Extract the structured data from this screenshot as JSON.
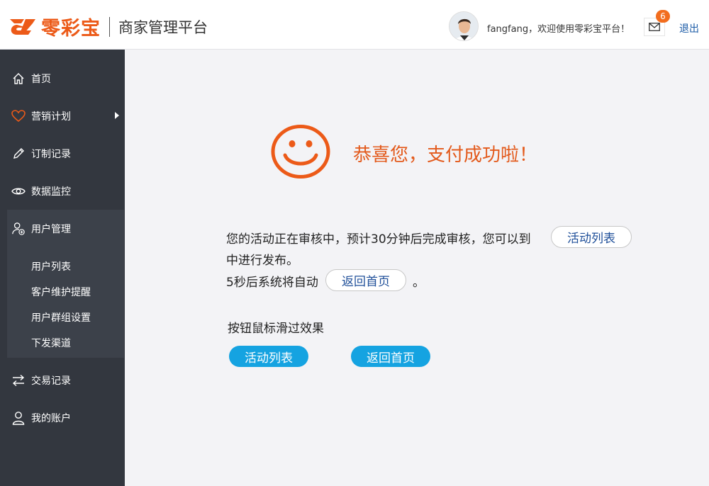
{
  "header": {
    "logo_text": "零彩宝",
    "platform_title": "商家管理平台",
    "welcome_text": "fangfang，欢迎使用零彩宝平台！",
    "mail_badge": "6",
    "logout_label": "退出"
  },
  "colors": {
    "brand_orange": "#ec5a18",
    "sidebar_bg": "#33373f",
    "submenu_bg": "#3c414a",
    "accent_blue": "#15a3e1",
    "link_blue": "#1a5aa6"
  },
  "sidebar": {
    "items": [
      {
        "label": "首页",
        "icon": "home-icon"
      },
      {
        "label": "营销计划",
        "icon": "heart-icon"
      },
      {
        "label": "订制记录",
        "icon": "pencil-icon"
      },
      {
        "label": "数据监控",
        "icon": "eye-icon"
      },
      {
        "label": "用户管理",
        "icon": "user-add-icon"
      },
      {
        "label": "交易记录",
        "icon": "exchange-icon"
      },
      {
        "label": "我的账户",
        "icon": "user-icon"
      }
    ],
    "submenu": [
      {
        "label": "用户列表"
      },
      {
        "label": "客户维护提醒"
      },
      {
        "label": "用户群组设置"
      },
      {
        "label": "下发渠道"
      }
    ]
  },
  "main": {
    "success_title": "恭喜您，支付成功啦！",
    "line1": "您的活动正在审核中，预计30分钟后完成审核，您可以到",
    "line2": "中进行发布。",
    "line3": "5秒后系统将自动",
    "line3_end": "。",
    "activity_list_label": "活动列表",
    "back_home_label": "返回首页",
    "hover_title": "按钮鼠标滑过效果",
    "hover_btn1": "活动列表",
    "hover_btn2": "返回首页"
  }
}
